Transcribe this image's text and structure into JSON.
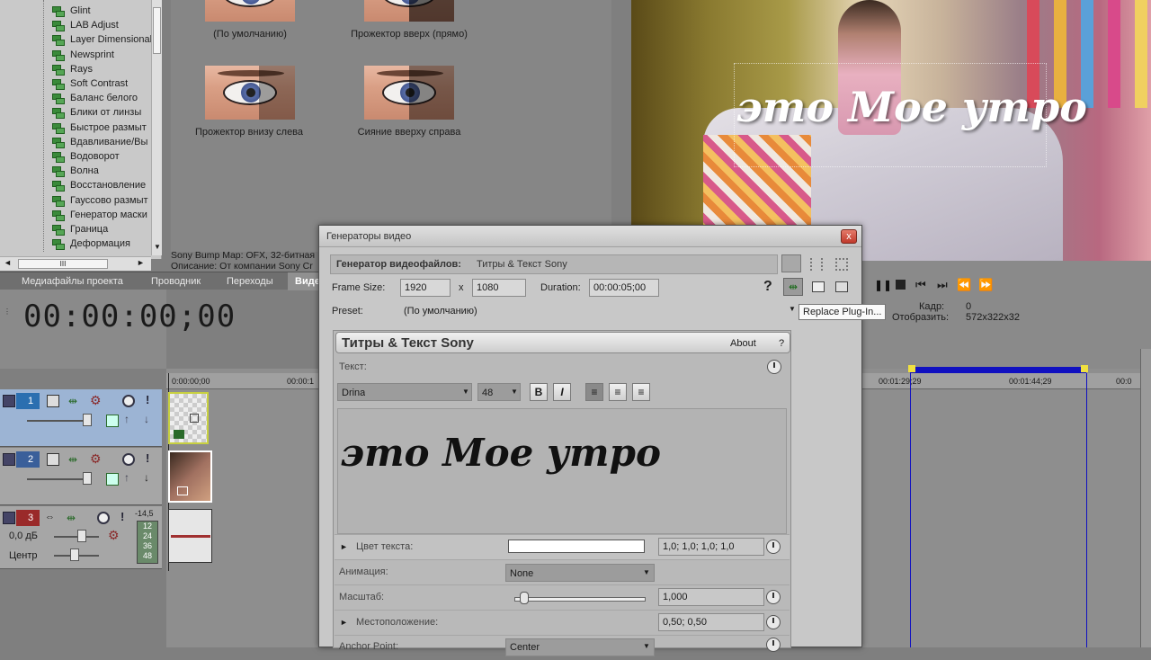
{
  "fx_list": {
    "items": [
      "Glint",
      "LAB Adjust",
      "Layer Dimensional",
      "Newsprint",
      "Rays",
      "Soft Contrast",
      "Баланс белого",
      "Блики от линзы",
      "Быстрое размыт",
      "Вдавливание/Вы",
      "Водоворот",
      "Волна",
      "Восстановление",
      "Гауссово размыт",
      "Генератор маски",
      "Граница",
      "Деформация"
    ],
    "scroll_label": "III"
  },
  "presets": {
    "items": [
      {
        "label": "(По умолчанию)"
      },
      {
        "label": "Прожектор вверх (прямо)"
      },
      {
        "label": "Прожектор внизу слева"
      },
      {
        "label": "Сияние вверху справа"
      }
    ],
    "description_line1": "Sony Bump Map: OFX, 32-битная",
    "description_line2": "Описание: От компании Sony Cr"
  },
  "preview": {
    "title_overlay": "это Мое утро",
    "frame_label": "Кадр:",
    "frame_value": "0",
    "display_label": "Отобразить:",
    "display_value": "572x322x32"
  },
  "tabs": [
    {
      "label": "Медиафайлы проекта"
    },
    {
      "label": "Проводник"
    },
    {
      "label": "Переходы"
    },
    {
      "label": "Виде"
    }
  ],
  "timecode": "00:00:00;00",
  "tracks": [
    {
      "number": "1",
      "color": "#2b6fb0"
    },
    {
      "number": "2",
      "color": "#3a5f9a"
    },
    {
      "number": "3",
      "color": "#9a2a2a",
      "volume_label": "0,0 дБ",
      "pan_label": "Центр",
      "meter_top": "-14,5",
      "meter_values": [
        "12",
        "24",
        "36",
        "48"
      ]
    }
  ],
  "ruler": {
    "marks": [
      "0:00:00;00",
      "00:00:1",
      "00:01:29;29",
      "00:01:44;29",
      "00:0"
    ]
  },
  "dialog": {
    "title": "Генераторы видео",
    "close_glyph": "x",
    "generator_label": "Генератор видеофайлов:",
    "generator_value": "Титры & Текст Sony",
    "frame_size_label": "Frame Size:",
    "width": "1920",
    "x_sep": "x",
    "height": "1080",
    "duration_label": "Duration:",
    "duration": "00:00:05;00",
    "help_glyph": "?",
    "preset_label": "Preset:",
    "preset_value": "(По умолчанию)",
    "tooltip": "Replace Plug-In...",
    "plugin": {
      "title": "Титры & Текст Sony",
      "about": "About",
      "help": "?",
      "text_label": "Текст:",
      "font": "Drina",
      "size": "48",
      "bold": "B",
      "italic": "I",
      "text_value": "это Мое утро",
      "color_label": "Цвет текста:",
      "color_value": "1,0; 1,0; 1,0; 1,0",
      "animation_label": "Анимация:",
      "animation_value": "None",
      "scale_label": "Масштаб:",
      "scale_value": "1,000",
      "scale_fraction": 0.08,
      "position_label": "Местоположение:",
      "position_value": "0,50; 0,50",
      "anchor_label": "Anchor Point:",
      "anchor_value": "Center"
    }
  },
  "colors": {
    "accent_blue": "#1010c0",
    "marker_yellow": "#f0e040"
  }
}
